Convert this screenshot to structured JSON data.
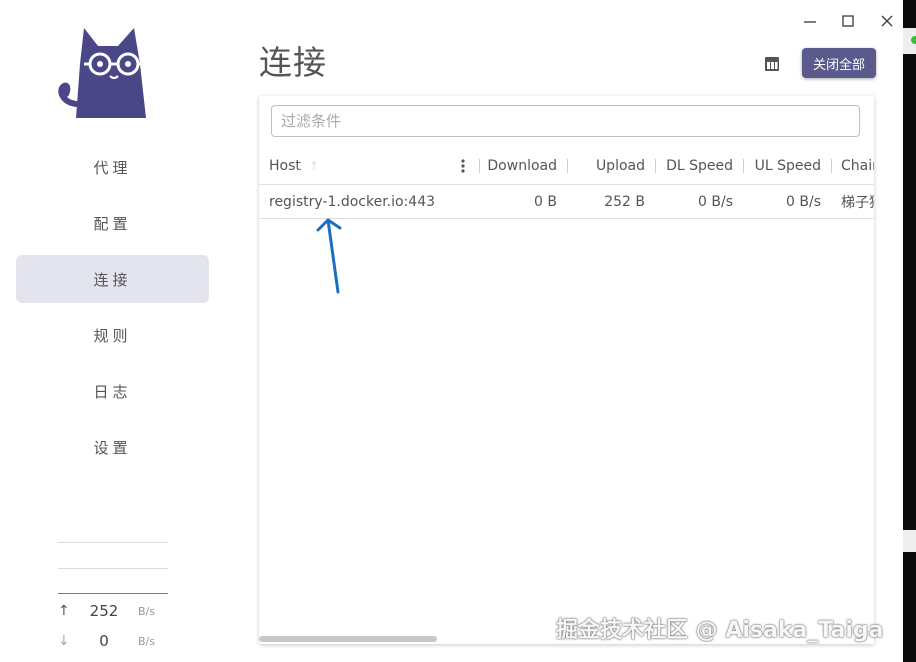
{
  "window": {
    "minimize_icon": "minimize-icon",
    "maximize_icon": "maximize-icon",
    "close_icon": "close-icon"
  },
  "sidebar": {
    "logo_icon": "cat-logo-icon",
    "items": [
      {
        "label": "代理",
        "active": false
      },
      {
        "label": "配置",
        "active": false
      },
      {
        "label": "连接",
        "active": true
      },
      {
        "label": "规则",
        "active": false
      },
      {
        "label": "日志",
        "active": false
      },
      {
        "label": "设置",
        "active": false
      }
    ],
    "traffic": {
      "up": {
        "value": "252",
        "unit": "B/s"
      },
      "down": {
        "value": "0",
        "unit": "B/s"
      }
    }
  },
  "header": {
    "title": "连接",
    "close_all_label": "关闭全部",
    "layout_icon": "table-layout-icon"
  },
  "filter": {
    "placeholder": "过滤条件",
    "value": ""
  },
  "table": {
    "columns": [
      "Host",
      "Download",
      "Upload",
      "DL Speed",
      "UL Speed",
      "Chain"
    ],
    "rows": [
      {
        "host": "registry-1.docker.io:443",
        "download": "0 B",
        "upload": "252 B",
        "dl_speed": "0 B/s",
        "ul_speed": "0 B/s",
        "chain": "梯子猫"
      }
    ]
  },
  "colors": {
    "accent": "#5a5a8c",
    "active_bg": "#e4e4ef",
    "annotation": "#1a6fc0"
  },
  "watermark": "掘金技术社区 @ Aisaka_Taiga"
}
